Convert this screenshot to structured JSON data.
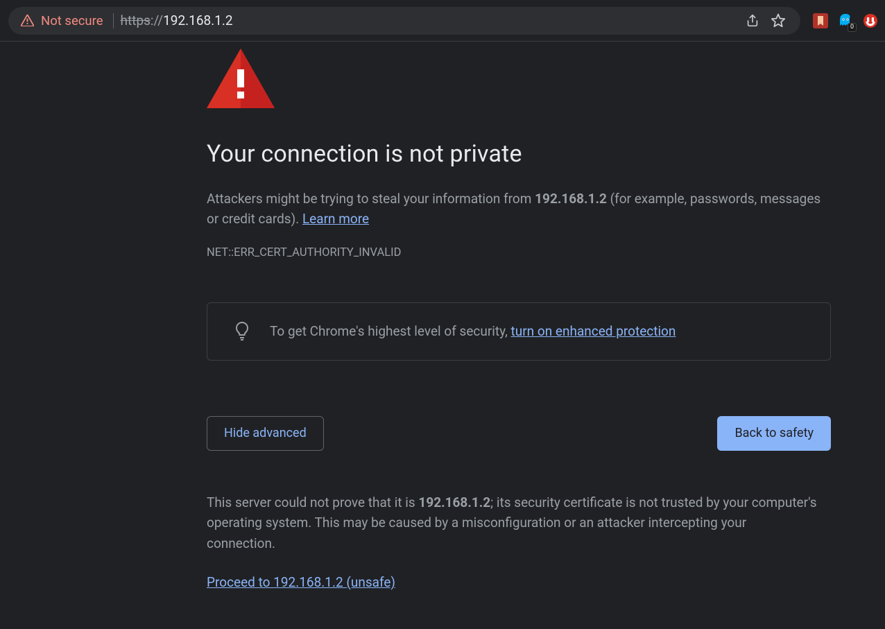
{
  "toolbar": {
    "security_chip": "Not secure",
    "url_protocol": "https",
    "url_suffix": "://",
    "url_host": "192.168.1.2",
    "share_icon": "share-icon",
    "star_icon": "star-icon",
    "extensions": [
      {
        "name": "extension-1",
        "color": "#b0332a"
      },
      {
        "name": "extension-ghostery",
        "color": "#00aef0",
        "badge": "0"
      },
      {
        "name": "extension-ublock",
        "color": "#d93025"
      }
    ]
  },
  "page": {
    "title": "Your connection is not private",
    "desc_before": "Attackers might be trying to steal your information from ",
    "desc_host": "192.168.1.2",
    "desc_after": " (for example, passwords, messages or credit cards). ",
    "learn_more": "Learn more",
    "error_code": "NET::ERR_CERT_AUTHORITY_INVALID",
    "tip_before": "To get Chrome's highest level of security, ",
    "tip_link": "turn on enhanced protection",
    "hide_advanced": "Hide advanced",
    "back_to_safety": "Back to safety",
    "advanced_before": "This server could not prove that it is ",
    "advanced_host": "192.168.1.2",
    "advanced_after": "; its security certificate is not trusted by your computer's operating system. This may be caused by a misconfiguration or an attacker intercepting your connection.",
    "proceed": "Proceed to 192.168.1.2 (unsafe)"
  }
}
